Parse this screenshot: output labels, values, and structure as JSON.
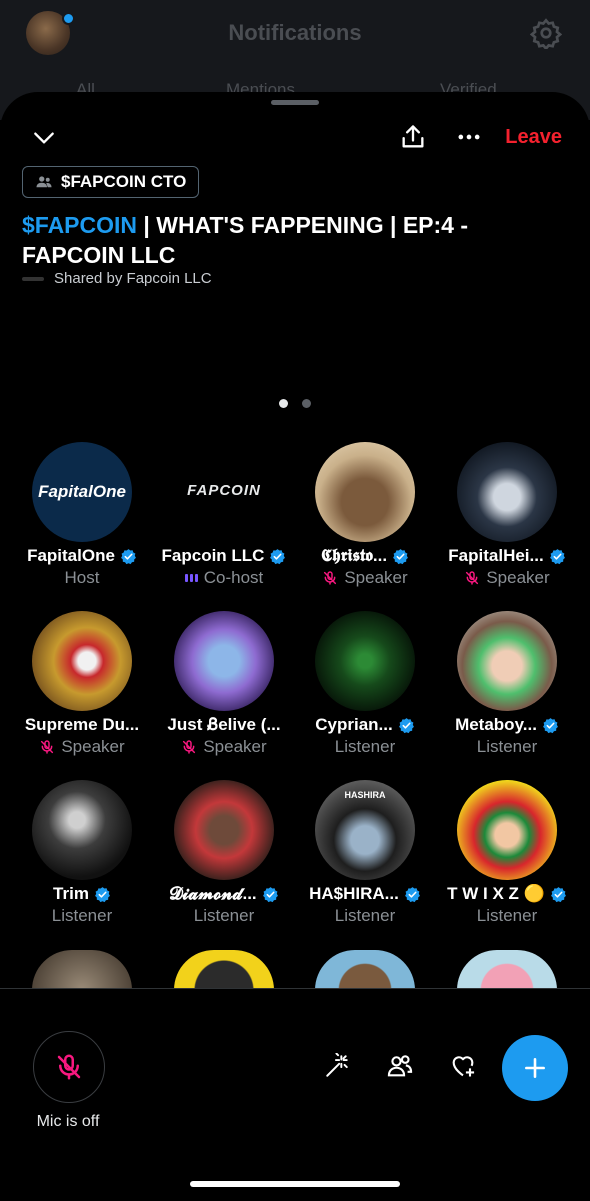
{
  "background": {
    "title": "Notifications",
    "tabs": [
      "All",
      "Mentions",
      "Verified"
    ]
  },
  "space": {
    "leave_label": "Leave",
    "community_label": "$FAPCOIN CTO",
    "title_highlight": "$FAPCOIN",
    "title_rest": " | WHAT'S FAPPENING | EP:4 - FAPCOIN LLC",
    "shared_by": "Shared by Fapcoin LLC",
    "page_dots": 2,
    "active_page": 1
  },
  "participants": [
    {
      "name": "FapitalOne",
      "role": "Host",
      "verified": true,
      "role_icon": "none",
      "avatar_text": "FapitalOne"
    },
    {
      "name": "Fapcoin LLC",
      "role": "Co-host",
      "verified": true,
      "role_icon": "cohost",
      "avatar_text": "FAPCOIN"
    },
    {
      "name": "𝕮𝖍𝖗𝖎𝖘𝖙𝖔...",
      "role": "Speaker",
      "verified": true,
      "role_icon": "muted",
      "avatar_text": ""
    },
    {
      "name": "FapitalHei...",
      "role": "Speaker",
      "verified": true,
      "role_icon": "muted",
      "avatar_text": ""
    },
    {
      "name": "Supreme Du...",
      "role": "Speaker",
      "verified": false,
      "role_icon": "muted",
      "avatar_text": ""
    },
    {
      "name": "Just Ᏸelive (...",
      "role": "Speaker",
      "verified": false,
      "role_icon": "muted",
      "avatar_text": ""
    },
    {
      "name": "Cyprian...",
      "role": "Listener",
      "verified": true,
      "role_icon": "none",
      "avatar_text": ""
    },
    {
      "name": "Metaboy...",
      "role": "Listener",
      "verified": true,
      "role_icon": "none",
      "avatar_text": ""
    },
    {
      "name": "Trim",
      "role": "Listener",
      "verified": true,
      "role_icon": "none",
      "avatar_text": ""
    },
    {
      "name": "𝓓𝓲𝓪𝓶𝓸𝓷𝓭...",
      "role": "Listener",
      "verified": true,
      "role_icon": "none",
      "avatar_text": ""
    },
    {
      "name": "HA$HIRA...",
      "role": "Listener",
      "verified": true,
      "role_icon": "none",
      "avatar_text": "HASHIRA"
    },
    {
      "name": "T W I X Z 🟡",
      "role": "Listener",
      "verified": true,
      "role_icon": "none",
      "avatar_text": ""
    }
  ],
  "bottom": {
    "mic_label": "Mic is off"
  },
  "colors": {
    "accent": "#1d9bf0",
    "leave": "#f4212e",
    "muted_mic": "#f91880",
    "cohost": "#7856ff",
    "secondary_text": "#8b9095"
  }
}
